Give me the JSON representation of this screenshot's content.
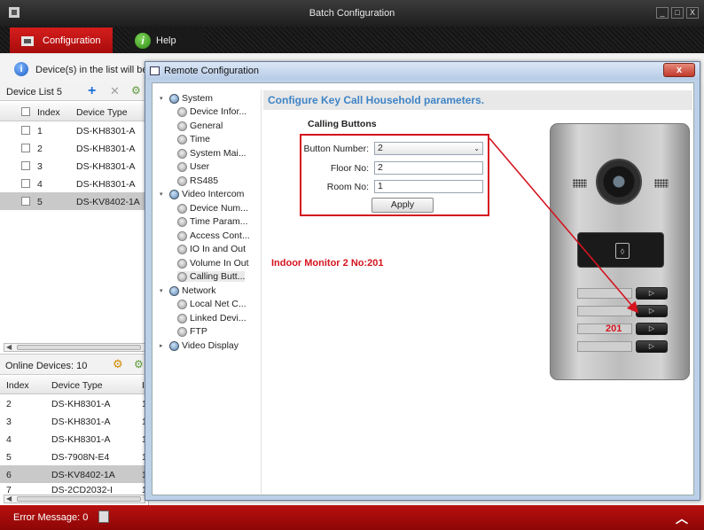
{
  "window": {
    "title": "Batch Configuration",
    "buttons": [
      "_",
      "□",
      "X"
    ]
  },
  "menu": {
    "configuration": "Configuration",
    "help": "Help"
  },
  "info": {
    "text": "Device(s) in the list will be co"
  },
  "device_list": {
    "title": "Device List 5",
    "columns": {
      "index": "Index",
      "device_type": "Device Type"
    },
    "rows": [
      {
        "index": "1",
        "type": "DS-KH8301-A"
      },
      {
        "index": "2",
        "type": "DS-KH8301-A"
      },
      {
        "index": "3",
        "type": "DS-KH8301-A"
      },
      {
        "index": "4",
        "type": "DS-KH8301-A"
      },
      {
        "index": "5",
        "type": "DS-KV8402-1A"
      }
    ]
  },
  "online_devices": {
    "title": "Online Devices: 10",
    "columns": {
      "index": "Index",
      "device_type": "Device Type",
      "extra": "I"
    },
    "rows": [
      {
        "index": "2",
        "type": "DS-KH8301-A",
        "extra": "1"
      },
      {
        "index": "3",
        "type": "DS-KH8301-A",
        "extra": "1"
      },
      {
        "index": "4",
        "type": "DS-KH8301-A",
        "extra": "1"
      },
      {
        "index": "5",
        "type": "DS-7908N-E4",
        "extra": "1"
      },
      {
        "index": "6",
        "type": "DS-KV8402-1A",
        "extra": "1"
      },
      {
        "index": "7",
        "type": "DS-2CD2032-I",
        "extra": "1"
      }
    ]
  },
  "error": {
    "text": "Error Message: 0"
  },
  "dialog": {
    "title": "Remote Configuration",
    "close": "x",
    "tree": {
      "system": "System",
      "device_info": "Device Infor...",
      "general": "General",
      "time": "Time",
      "system_maint": "System Mai...",
      "user": "User",
      "rs485": "RS485",
      "video_intercom": "Video Intercom",
      "device_num": "Device Num...",
      "time_param": "Time Param...",
      "access_control": "Access Cont...",
      "io": "IO In and Out",
      "volume": "Volume In Out",
      "calling_button": "Calling Butt...",
      "network": "Network",
      "local_net": "Local Net C...",
      "linked_devices": "Linked Devi...",
      "ftp": "FTP",
      "video_display": "Video Display"
    },
    "header": "Configure Key Call Household parameters.",
    "section": "Calling Buttons",
    "form": {
      "button_number_label": "Button Number:",
      "button_number_value": "2",
      "floor_label": "Floor No:",
      "floor_value": "2",
      "room_label": "Room No:",
      "room_value": "1",
      "apply": "Apply"
    },
    "annotation": "Indoor Monitor 2 No:201",
    "station_label": "201"
  },
  "colors": {
    "accent_red": "#d4141f",
    "header_blue": "#3f84c6",
    "menu_red": "#c41414"
  }
}
